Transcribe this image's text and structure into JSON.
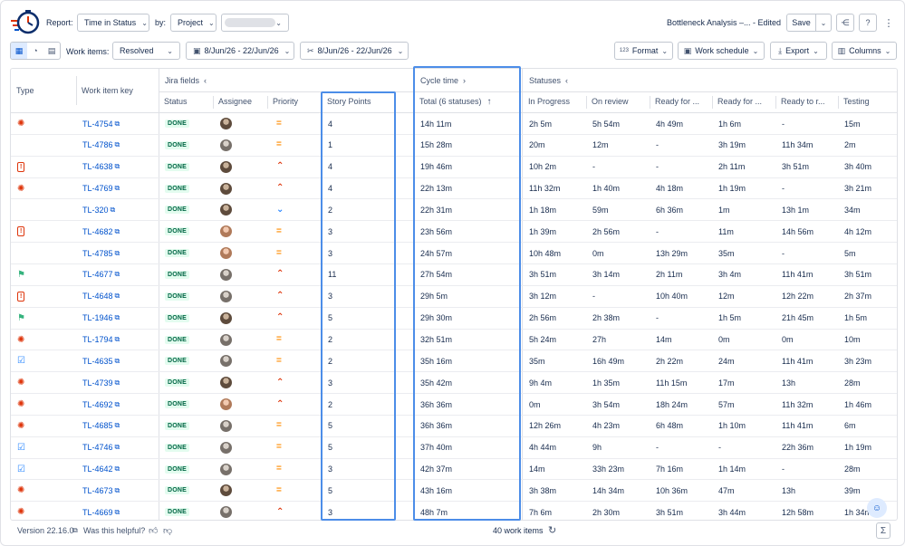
{
  "toolbar": {
    "report_label": "Report:",
    "report_value": "Time in Status",
    "by_label": "by:",
    "by_value": "Project",
    "doc_title": "Bottleneck Analysis –... - Edited",
    "save_label": "Save"
  },
  "filters": {
    "work_items_label": "Work items:",
    "work_items_value": "Resolved",
    "date_range_1": "8/Jun/26 - 22/Jun/26",
    "date_range_2": "8/Jun/26 - 22/Jun/26",
    "format_label": "Format",
    "format_prefix": "123",
    "schedule_label": "Work schedule",
    "export_label": "Export",
    "columns_label": "Columns"
  },
  "table": {
    "groups": {
      "jira_fields": "Jira fields",
      "cycle_time": "Cycle time",
      "statuses": "Statuses"
    },
    "headers": {
      "type": "Type",
      "key": "Work item key",
      "status": "Status",
      "assignee": "Assignee",
      "priority": "Priority",
      "story_points": "Story Points",
      "total": "Total (6 statuses)",
      "in_progress": "In Progress",
      "on_review": "On review",
      "ready_for_1": "Ready for ...",
      "ready_for_2": "Ready for ...",
      "ready_to_r": "Ready to r...",
      "testing": "Testing"
    },
    "status_label": "DONE",
    "rows": [
      {
        "type": "bug",
        "key": "TL-4754",
        "avatar": "dark",
        "priority": "medium",
        "sp": "4",
        "total": "14h 11m",
        "inprog": "2h 5m",
        "review": "5h 54m",
        "rf1": "4h 49m",
        "rf2": "1h 6m",
        "rtr": "-",
        "test": "15m"
      },
      {
        "type": "code",
        "key": "TL-4786",
        "avatar": "grey",
        "priority": "medium",
        "sp": "1",
        "total": "15h 28m",
        "inprog": "20m",
        "review": "12m",
        "rf1": "-",
        "rf2": "3h 19m",
        "rtr": "11h 34m",
        "test": "2m"
      },
      {
        "type": "incident",
        "key": "TL-4638",
        "avatar": "dark",
        "priority": "high",
        "sp": "4",
        "total": "19h 46m",
        "inprog": "10h 2m",
        "review": "-",
        "rf1": "-",
        "rf2": "2h 11m",
        "rtr": "3h 51m",
        "test": "3h 40m"
      },
      {
        "type": "bug",
        "key": "TL-4769",
        "avatar": "dark",
        "priority": "high",
        "sp": "4",
        "total": "22h 13m",
        "inprog": "11h 32m",
        "review": "1h 40m",
        "rf1": "4h 18m",
        "rf2": "1h 19m",
        "rtr": "-",
        "test": "3h 21m"
      },
      {
        "type": "code",
        "key": "TL-320",
        "avatar": "dark",
        "priority": "low",
        "sp": "2",
        "total": "22h 31m",
        "inprog": "1h 18m",
        "review": "59m",
        "rf1": "6h 36m",
        "rf2": "1m",
        "rtr": "13h 1m",
        "test": "34m"
      },
      {
        "type": "incident",
        "key": "TL-4682",
        "avatar": "light",
        "priority": "medium",
        "sp": "3",
        "total": "23h 56m",
        "inprog": "1h 39m",
        "review": "2h 56m",
        "rf1": "-",
        "rf2": "11m",
        "rtr": "14h 56m",
        "test": "4h 12m"
      },
      {
        "type": "code",
        "key": "TL-4785",
        "avatar": "light",
        "priority": "medium",
        "sp": "3",
        "total": "24h 57m",
        "inprog": "10h 48m",
        "review": "0m",
        "rf1": "13h 29m",
        "rf2": "35m",
        "rtr": "-",
        "test": "5m"
      },
      {
        "type": "story",
        "key": "TL-4677",
        "avatar": "grey",
        "priority": "high",
        "sp": "11",
        "total": "27h 54m",
        "inprog": "3h 51m",
        "review": "3h 14m",
        "rf1": "2h 11m",
        "rf2": "3h 4m",
        "rtr": "11h 41m",
        "test": "3h 51m"
      },
      {
        "type": "incident",
        "key": "TL-4648",
        "avatar": "grey",
        "priority": "high",
        "sp": "3",
        "total": "29h 5m",
        "inprog": "3h 12m",
        "review": "-",
        "rf1": "10h 40m",
        "rf2": "12m",
        "rtr": "12h 22m",
        "test": "2h 37m"
      },
      {
        "type": "story",
        "key": "TL-1946",
        "avatar": "dark",
        "priority": "high",
        "sp": "5",
        "total": "29h 30m",
        "inprog": "2h 56m",
        "review": "2h 38m",
        "rf1": "-",
        "rf2": "1h 5m",
        "rtr": "21h 45m",
        "test": "1h 5m"
      },
      {
        "type": "bug",
        "key": "TL-1794",
        "avatar": "grey",
        "priority": "medium",
        "sp": "2",
        "total": "32h 51m",
        "inprog": "5h 24m",
        "review": "27h",
        "rf1": "14m",
        "rf2": "0m",
        "rtr": "0m",
        "test": "10m"
      },
      {
        "type": "task",
        "key": "TL-4635",
        "avatar": "grey",
        "priority": "medium",
        "sp": "2",
        "total": "35h 16m",
        "inprog": "35m",
        "review": "16h 49m",
        "rf1": "2h 22m",
        "rf2": "24m",
        "rtr": "11h 41m",
        "test": "3h 23m"
      },
      {
        "type": "bug",
        "key": "TL-4739",
        "avatar": "dark",
        "priority": "high",
        "sp": "3",
        "total": "35h 42m",
        "inprog": "9h 4m",
        "review": "1h 35m",
        "rf1": "11h 15m",
        "rf2": "17m",
        "rtr": "13h",
        "test": "28m"
      },
      {
        "type": "bug",
        "key": "TL-4692",
        "avatar": "light",
        "priority": "high",
        "sp": "2",
        "total": "36h 36m",
        "inprog": "0m",
        "review": "3h 54m",
        "rf1": "18h 24m",
        "rf2": "57m",
        "rtr": "11h 32m",
        "test": "1h 46m"
      },
      {
        "type": "bug",
        "key": "TL-4685",
        "avatar": "grey",
        "priority": "medium",
        "sp": "5",
        "total": "36h 36m",
        "inprog": "12h 26m",
        "review": "4h 23m",
        "rf1": "6h 48m",
        "rf2": "1h 10m",
        "rtr": "11h 41m",
        "test": "6m"
      },
      {
        "type": "task",
        "key": "TL-4746",
        "avatar": "grey",
        "priority": "medium",
        "sp": "5",
        "total": "37h 40m",
        "inprog": "4h 44m",
        "review": "9h",
        "rf1": "-",
        "rf2": "-",
        "rtr": "22h 36m",
        "test": "1h 19m"
      },
      {
        "type": "task",
        "key": "TL-4642",
        "avatar": "grey",
        "priority": "medium",
        "sp": "3",
        "total": "42h 37m",
        "inprog": "14m",
        "review": "33h 23m",
        "rf1": "7h 16m",
        "rf2": "1h 14m",
        "rtr": "-",
        "test": "28m"
      },
      {
        "type": "bug",
        "key": "TL-4673",
        "avatar": "dark",
        "priority": "medium",
        "sp": "5",
        "total": "43h 16m",
        "inprog": "3h 38m",
        "review": "14h 34m",
        "rf1": "10h 36m",
        "rf2": "47m",
        "rtr": "13h",
        "test": "39m"
      },
      {
        "type": "bug",
        "key": "TL-4669",
        "avatar": "grey",
        "priority": "high",
        "sp": "3",
        "total": "48h 7m",
        "inprog": "7h 6m",
        "review": "2h 30m",
        "rf1": "3h 51m",
        "rf2": "3h 44m",
        "rtr": "12h 58m",
        "test": "1h 34m"
      }
    ]
  },
  "footer": {
    "version": "Version 22.16.0",
    "helpful": "Was this helpful?",
    "count": "40 work items"
  },
  "colors": {
    "accent": "#0052cc",
    "highlight": "#4c8de8",
    "bug": "#de350b",
    "story": "#36b37e",
    "task": "#2684ff",
    "priority_medium": "#ff8b00",
    "priority_high": "#de350b",
    "priority_low": "#2684ff"
  }
}
